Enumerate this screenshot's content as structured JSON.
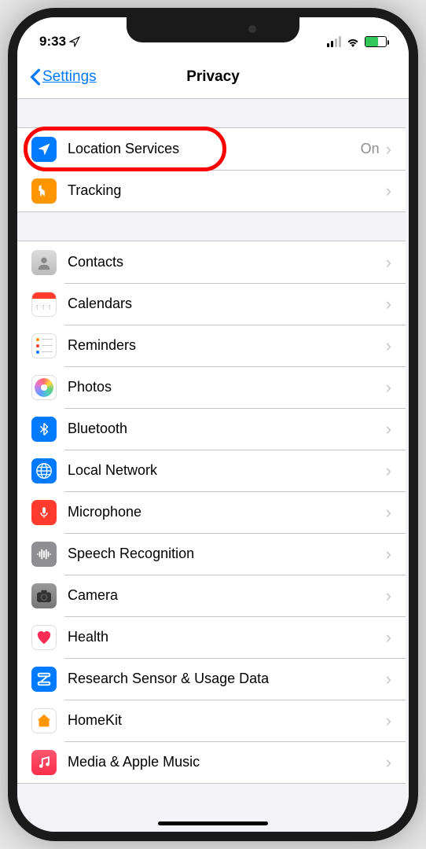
{
  "status": {
    "time": "9:33",
    "location_indicator": true
  },
  "nav": {
    "back_label": "Settings",
    "title": "Privacy"
  },
  "sections": [
    {
      "rows": [
        {
          "id": "location",
          "icon": "location-icon",
          "label": "Location Services",
          "value": "On",
          "highlighted": true
        },
        {
          "id": "tracking",
          "icon": "tracking-icon",
          "label": "Tracking",
          "value": ""
        }
      ]
    },
    {
      "rows": [
        {
          "id": "contacts",
          "icon": "contacts-icon",
          "label": "Contacts",
          "value": ""
        },
        {
          "id": "calendars",
          "icon": "calendars-icon",
          "label": "Calendars",
          "value": ""
        },
        {
          "id": "reminders",
          "icon": "reminders-icon",
          "label": "Reminders",
          "value": ""
        },
        {
          "id": "photos",
          "icon": "photos-icon",
          "label": "Photos",
          "value": ""
        },
        {
          "id": "bluetooth",
          "icon": "bluetooth-icon",
          "label": "Bluetooth",
          "value": ""
        },
        {
          "id": "network",
          "icon": "network-icon",
          "label": "Local Network",
          "value": ""
        },
        {
          "id": "microphone",
          "icon": "microphone-icon",
          "label": "Microphone",
          "value": ""
        },
        {
          "id": "speech",
          "icon": "speech-icon",
          "label": "Speech Recognition",
          "value": ""
        },
        {
          "id": "camera",
          "icon": "camera-icon",
          "label": "Camera",
          "value": ""
        },
        {
          "id": "health",
          "icon": "health-icon",
          "label": "Health",
          "value": ""
        },
        {
          "id": "research",
          "icon": "research-icon",
          "label": "Research Sensor & Usage Data",
          "value": ""
        },
        {
          "id": "homekit",
          "icon": "homekit-icon",
          "label": "HomeKit",
          "value": ""
        },
        {
          "id": "music",
          "icon": "music-icon",
          "label": "Media & Apple Music",
          "value": ""
        }
      ]
    }
  ]
}
